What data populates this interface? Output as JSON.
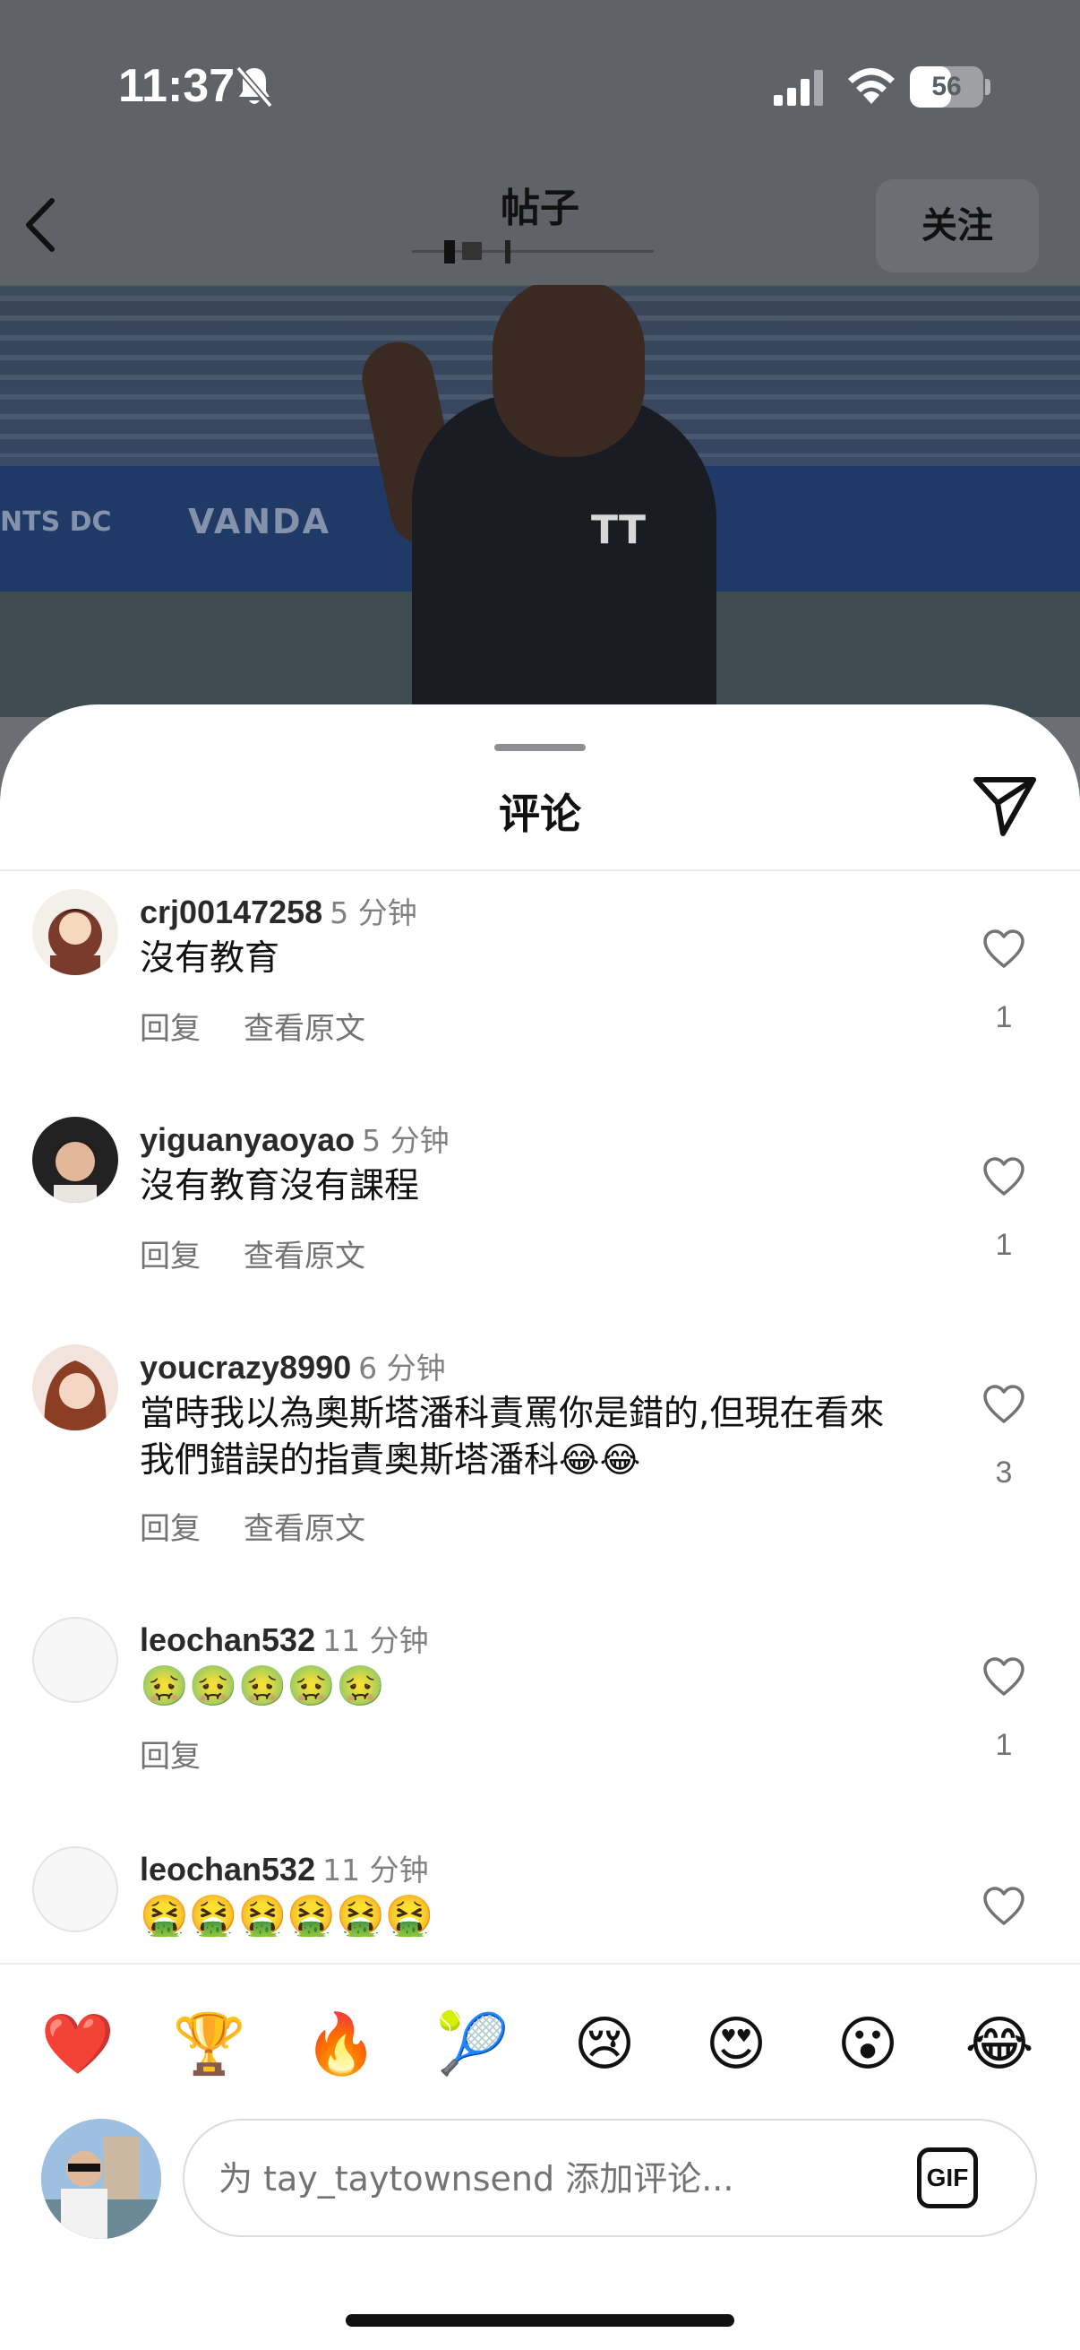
{
  "status_bar": {
    "time": "11:37",
    "battery": "56",
    "battery_level": 0.56
  },
  "nav": {
    "title": "帖子",
    "follow_label": "关注"
  },
  "photo": {
    "banner_text": "VANDA",
    "banner_text_left": "NTS DC",
    "shirt_logo": "TT"
  },
  "sheet": {
    "title": "评论"
  },
  "comments": [
    {
      "username": "crj00147258",
      "time": "5 分钟",
      "text": "沒有教育",
      "reply": "回复",
      "see_original": "查看原文",
      "likes": "1"
    },
    {
      "username": "yiguanyaoyao",
      "time": "5 分钟",
      "text": "沒有教育沒有課程",
      "reply": "回复",
      "see_original": "查看原文",
      "likes": "1"
    },
    {
      "username": "youcrazy8990",
      "time": "6 分钟",
      "text": "當時我以為奧斯塔潘科責罵你是錯的,但現在看來我們錯誤的指責奧斯塔潘科😂😂",
      "reply": "回复",
      "see_original": "查看原文",
      "likes": "3"
    },
    {
      "username": "leochan532",
      "time": "11 分钟",
      "text": "🤢🤢🤢🤢🤢",
      "reply": "回复",
      "likes": "1"
    },
    {
      "username": "leochan532",
      "time": "11 分钟",
      "text": "🤮🤮🤮🤮🤮🤮"
    }
  ],
  "quick_emojis": [
    "❤️",
    "🏆",
    "🔥",
    "🎾",
    "😢",
    "😍",
    "😮",
    "😂"
  ],
  "composer": {
    "placeholder": "为 tay_taytownsend 添加评论...",
    "gif_label": "GIF"
  }
}
